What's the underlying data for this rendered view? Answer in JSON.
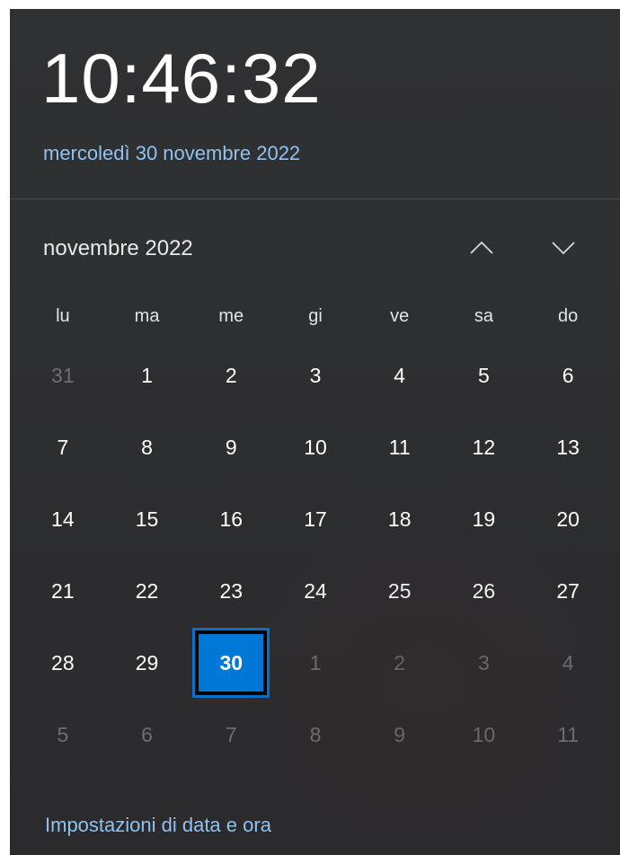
{
  "clock": {
    "time": "10:46:32",
    "full_date": "mercoledì 30 novembre 2022"
  },
  "calendar": {
    "month_label": "novembre 2022",
    "nav": {
      "prev_icon": "chevron-up-icon",
      "next_icon": "chevron-down-icon"
    },
    "weekdays": [
      "lu",
      "ma",
      "me",
      "gi",
      "ve",
      "sa",
      "do"
    ],
    "weeks": [
      [
        "31",
        "1",
        "2",
        "3",
        "4",
        "5",
        "6"
      ],
      [
        "7",
        "8",
        "9",
        "10",
        "11",
        "12",
        "13"
      ],
      [
        "14",
        "15",
        "16",
        "17",
        "18",
        "19",
        "20"
      ],
      [
        "21",
        "22",
        "23",
        "24",
        "25",
        "26",
        "27"
      ],
      [
        "28",
        "29",
        "30",
        "1",
        "2",
        "3",
        "4"
      ],
      [
        "5",
        "6",
        "7",
        "8",
        "9",
        "10",
        "11"
      ]
    ],
    "today": "30",
    "colors": {
      "accent": "#0078d7",
      "link": "#8fc2ef",
      "outside_day": "#6e6f71"
    }
  },
  "footer": {
    "settings_link": "Impostazioni di data e ora"
  }
}
